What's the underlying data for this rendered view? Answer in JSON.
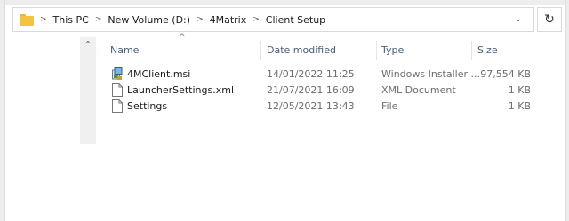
{
  "breadcrumb": {
    "items": [
      "This PC",
      "New Volume (D:)",
      "4Matrix",
      "Client Setup"
    ],
    "separator": ">"
  },
  "address_bar": {
    "dropdown_glyph": "⌄",
    "refresh_glyph": "↻"
  },
  "nav_pane": {
    "scroll_up_glyph": "^"
  },
  "columns": {
    "name": "Name",
    "date": "Date modified",
    "type": "Type",
    "size": "Size",
    "sort_glyph": "^"
  },
  "files": [
    {
      "name": "4MClient.msi",
      "date": "14/01/2022 11:25",
      "type": "Windows Installer ...",
      "size": "97,554 KB",
      "icon": "msi-installer-icon"
    },
    {
      "name": "LauncherSettings.xml",
      "date": "21/07/2021 16:09",
      "type": "XML Document",
      "size": "1 KB",
      "icon": "document-icon"
    },
    {
      "name": "Settings",
      "date": "12/05/2021 13:43",
      "type": "File",
      "size": "1 KB",
      "icon": "document-icon"
    }
  ],
  "colors": {
    "folder": "#f5c342",
    "header_text": "#4a6079",
    "secondary_text": "#6d6d6d"
  }
}
